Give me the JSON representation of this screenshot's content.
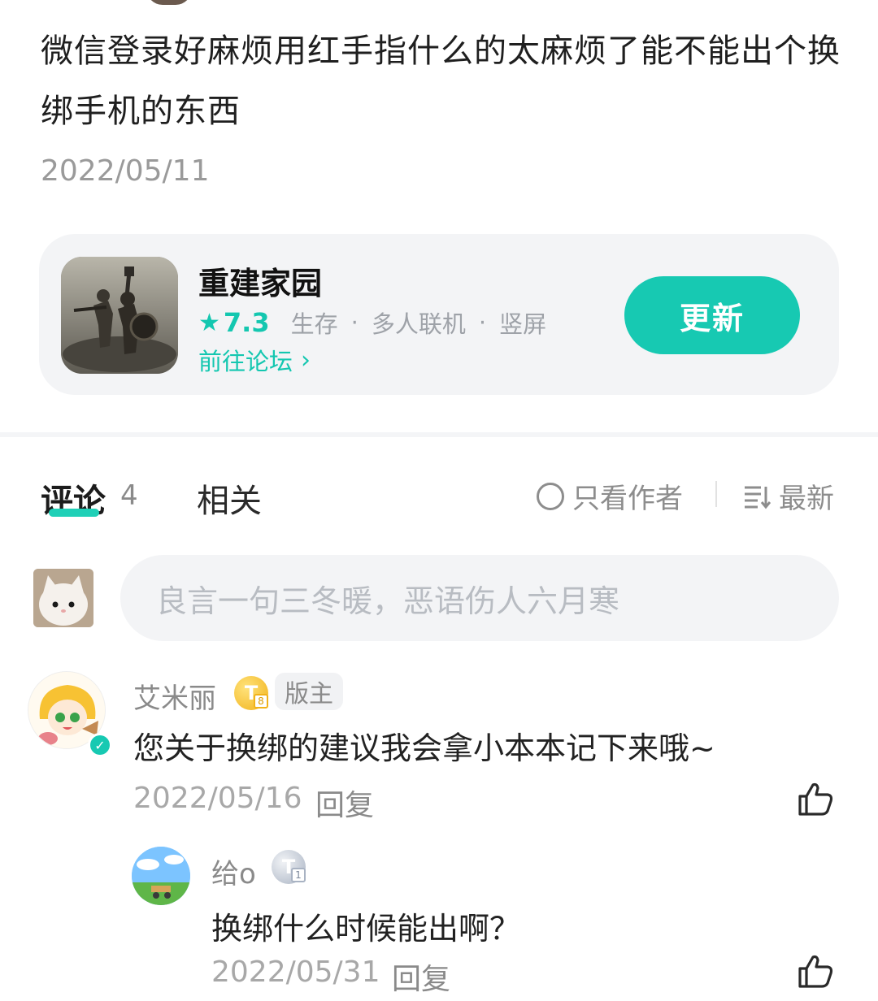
{
  "post": {
    "text": "微信登录好麻烦用红手指什么的太麻烦了能不能出个换绑手机的东西",
    "date": "2022/05/11"
  },
  "game_card": {
    "name": "重建家园",
    "rating_star": "★",
    "rating": "7.3",
    "tags": [
      "生存",
      "多人联机",
      "竖屏"
    ],
    "tag_separator": "·",
    "forum_link": "前往论坛",
    "forum_chevron": "›",
    "update_button": "更新",
    "accent_color": "#17c9b2"
  },
  "tabs": {
    "comments_label": "评论",
    "comments_count": "4",
    "related_label": "相关"
  },
  "filters": {
    "author_only": "只看作者",
    "sort_latest": "最新"
  },
  "comment_input": {
    "placeholder": "良言一句三冬暖，恶语伤人六月寒"
  },
  "comments": [
    {
      "user": "艾米丽",
      "level_badge": "T",
      "level_sub": "8",
      "role_badge": "版主",
      "verified_icon": "✓",
      "text": "您关于换绑的建议我会拿小本本记下来哦~",
      "date": "2022/05/16",
      "reply_label": "回复"
    },
    {
      "user": "给o",
      "level_badge": "T",
      "level_sub": "1",
      "text": "换绑什么时候能出啊？",
      "date": "2022/05/31",
      "reply_label": "回复"
    }
  ]
}
